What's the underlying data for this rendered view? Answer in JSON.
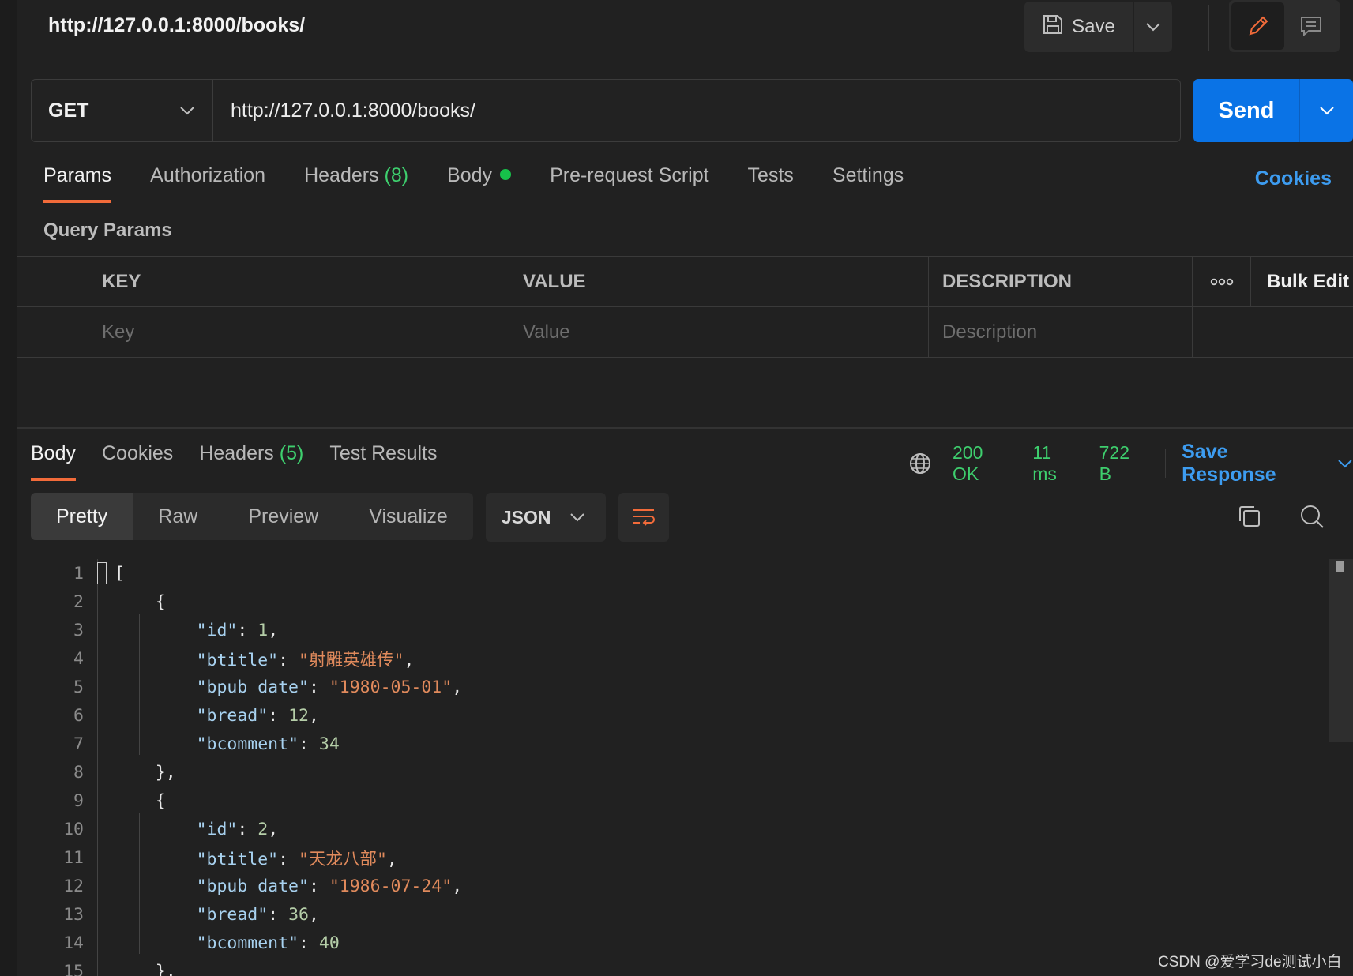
{
  "header": {
    "title": "http://127.0.0.1:8000/books/",
    "save_label": "Save"
  },
  "request": {
    "method": "GET",
    "url": "http://127.0.0.1:8000/books/",
    "send_label": "Send"
  },
  "request_tabs": {
    "params": "Params",
    "authorization": "Authorization",
    "headers": "Headers",
    "headers_count": "(8)",
    "body": "Body",
    "pre_request": "Pre-request Script",
    "tests": "Tests",
    "settings": "Settings",
    "cookies": "Cookies"
  },
  "query_params": {
    "title": "Query Params",
    "columns": [
      "KEY",
      "VALUE",
      "DESCRIPTION"
    ],
    "bulk_edit": "Bulk Edit",
    "placeholders": {
      "key": "Key",
      "value": "Value",
      "description": "Description"
    }
  },
  "response_tabs": {
    "body": "Body",
    "cookies": "Cookies",
    "headers": "Headers",
    "headers_count": "(5)",
    "test_results": "Test Results"
  },
  "response_status": {
    "status": "200 OK",
    "time": "11 ms",
    "size": "722 B",
    "save_response": "Save Response"
  },
  "view_modes": [
    "Pretty",
    "Raw",
    "Preview",
    "Visualize"
  ],
  "format": "JSON",
  "code_lines": [
    "1",
    "2",
    "3",
    "4",
    "5",
    "6",
    "7",
    "8",
    "9",
    "10",
    "11",
    "12",
    "13",
    "14",
    "15"
  ],
  "watermark": "CSDN @爱学习de测试小白",
  "colors": {
    "accent": "#f26b3a",
    "send": "#0a73e6",
    "link": "#3d9cf0",
    "success": "#3ecf6e",
    "json_key": "#a8d2f0",
    "json_string": "#e08a5c",
    "json_number": "#b5cea8"
  }
}
